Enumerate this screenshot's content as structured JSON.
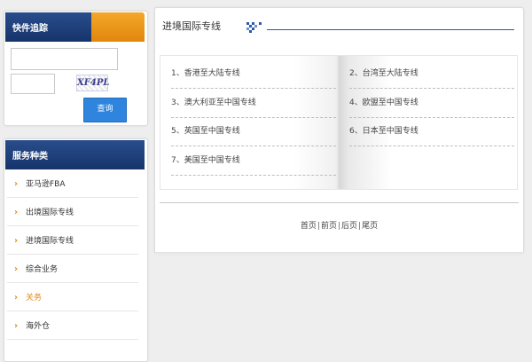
{
  "tracking": {
    "title": "快件追踪",
    "tracking_placeholder": "",
    "captcha_text": "XF4PL",
    "query_label": "查询"
  },
  "services": {
    "title": "服务种类",
    "items": [
      {
        "label": "亚马逊FBA"
      },
      {
        "label": "出境国际专线"
      },
      {
        "label": "进境国际专线"
      },
      {
        "label": "综合业务"
      },
      {
        "label": "关务",
        "active": true
      },
      {
        "label": "海外仓"
      }
    ]
  },
  "main": {
    "title": "进境国际专线",
    "lines": [
      "1、香港至大陆专线",
      "2、台湾至大陆专线",
      "3、澳大利亚至中国专线",
      "4、欧盟至中国专线",
      "5、英国至中国专线",
      "6、日本至中国专线",
      "7、美国至中国专线"
    ],
    "pager": {
      "first": "首页",
      "prev": "前页",
      "next": "后页",
      "last": "尾页",
      "separator": "|"
    }
  },
  "colors": {
    "header_blue": "#1f4281",
    "header_orange": "#e8920f",
    "accent_orange": "#e28a16",
    "button_blue": "#2f85de"
  }
}
